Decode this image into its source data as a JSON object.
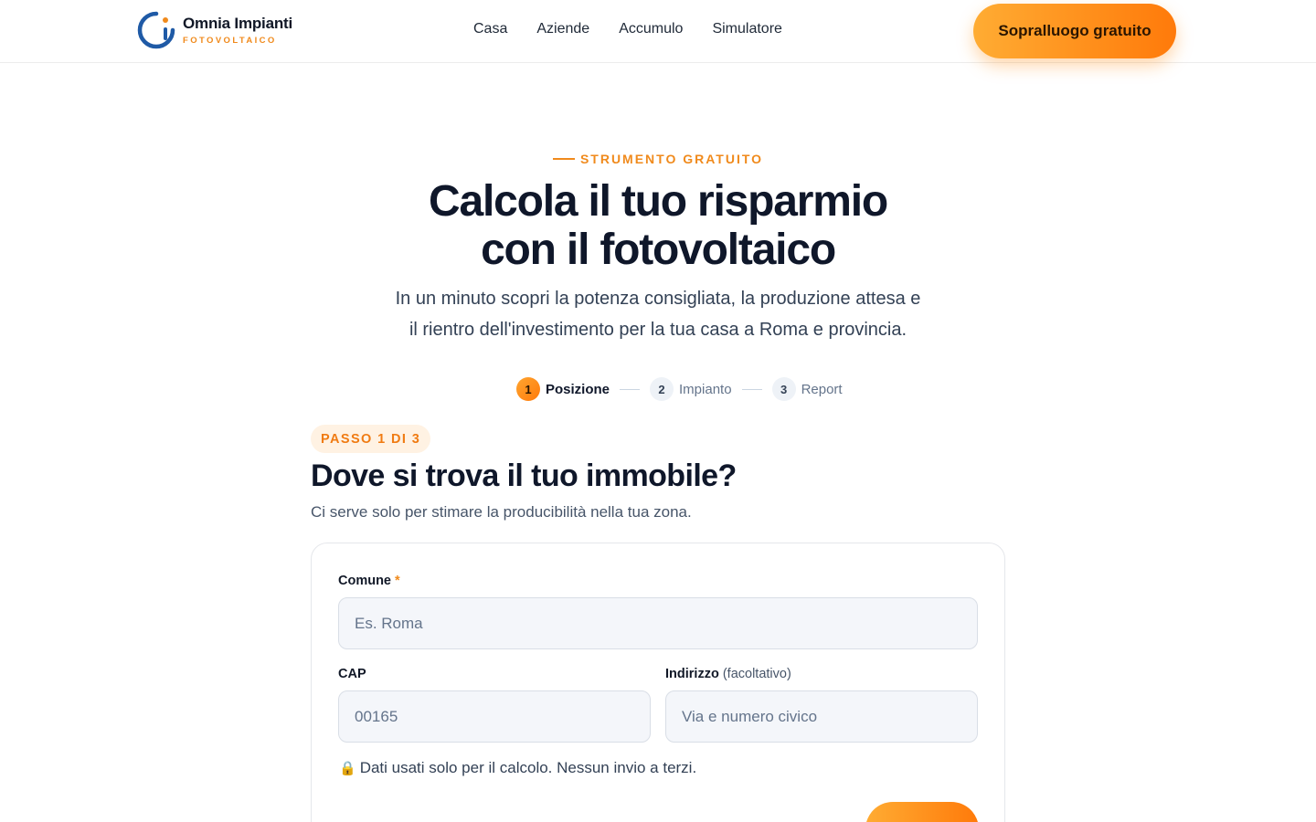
{
  "brand": {
    "name": "Omnia Impianti",
    "tagline": "FOTOVOLTAICO",
    "accent": "#f08a1c"
  },
  "nav": {
    "items": [
      {
        "label": "Casa"
      },
      {
        "label": "Aziende"
      },
      {
        "label": "Accumulo"
      },
      {
        "label": "Simulatore"
      }
    ],
    "cta_label": "Sopralluogo gratuito"
  },
  "hero": {
    "eyebrow": "STRUMENTO GRATUITO",
    "title_line1": "Calcola il tuo risparmio",
    "title_line2": "con il fotovoltaico",
    "subtitle_line1": "In un minuto scopri la potenza consigliata, la produzione attesa e",
    "subtitle_line2": "il rientro dell'investimento per la tua casa a Roma e provincia."
  },
  "steps": [
    {
      "num": "1",
      "label": "Posizione",
      "active": true
    },
    {
      "num": "2",
      "label": "Impianto",
      "active": false
    },
    {
      "num": "3",
      "label": "Report",
      "active": false
    }
  ],
  "form": {
    "badge": "PASSO 1 DI 3",
    "title": "Dove si trova il tuo immobile?",
    "subtitle": "Ci serve solo per stimare la producibilità nella tua zona.",
    "comune": {
      "label": "Comune",
      "required": "*",
      "placeholder": "Es. Roma",
      "value": ""
    },
    "cap": {
      "label": "CAP",
      "placeholder": "00165",
      "value": ""
    },
    "indirizzo": {
      "label": "Indirizzo",
      "optional": "(facoltativo)",
      "placeholder": "Via e numero civico",
      "value": ""
    },
    "privacy_icon": "lock-icon",
    "privacy": "Dati usati solo per il calcolo. Nessun invio a terzi."
  }
}
